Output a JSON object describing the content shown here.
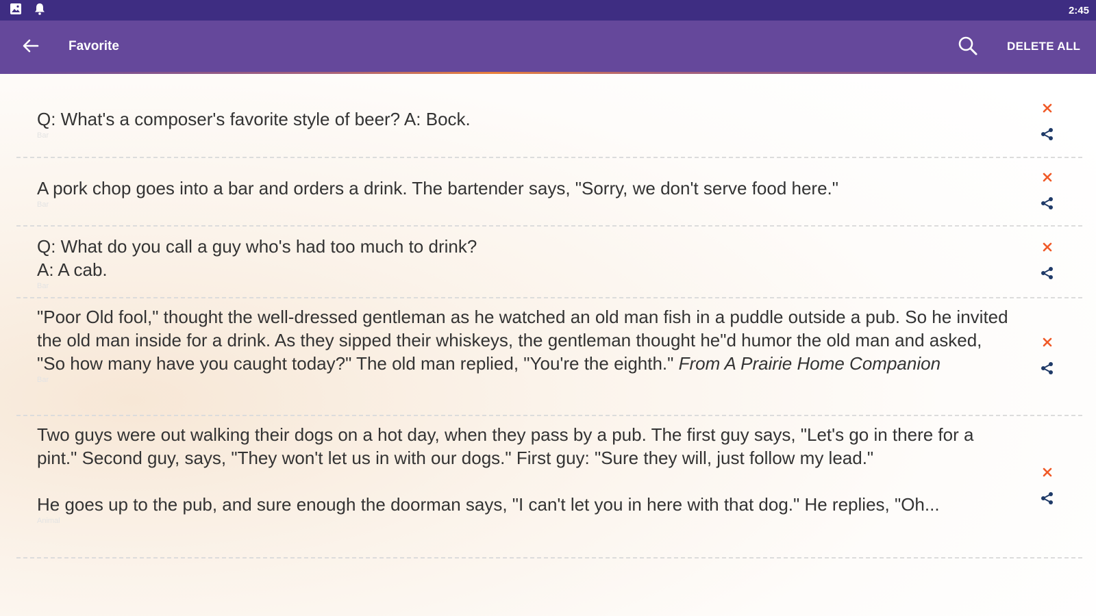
{
  "status_bar": {
    "time": "2:45",
    "icons": [
      "image-icon",
      "notification-bell-icon"
    ]
  },
  "app_bar": {
    "title": "Favorite",
    "back_icon": "arrow-back-icon",
    "search_icon": "search-icon",
    "delete_all_label": "DELETE ALL"
  },
  "colors": {
    "status_bar": "#3e2d82",
    "app_bar": "#65489b",
    "accent": "#f05a28",
    "share_icon": "#1f3a68",
    "text": "#333333"
  },
  "jokes": [
    {
      "text": "Q: What's a composer's favorite style of beer? A: Bock.",
      "category": "Bar"
    },
    {
      "text": "A pork chop goes into a bar and orders a drink. The bartender says, \"Sorry, we don't serve food here.\"",
      "category": "Bar"
    },
    {
      "text": "Q: What do you call a guy who's had too much to drink?\nA: A cab.",
      "category": "Bar"
    },
    {
      "text": "\"Poor Old fool,\" thought the well-dressed gentleman as he watched an old man fish in a puddle outside a pub. So he invited the old man inside for a drink. As they sipped their whiskeys, the gentleman thought he\"d humor the old man and asked, \"So how many have you caught today?\" The old man replied, \"You're the eighth.\"",
      "source": "From A Prairie Home Companion",
      "category": "Bar"
    },
    {
      "text": "Two guys were out walking their dogs on a hot day, when they pass by a pub. The first guy says, \"Let's go in there for a pint.\" Second guy, says, \"They won't let us in with our dogs.\" First guy: \"Sure they will, just follow my lead.\"",
      "text_more": "He goes up to the pub, and sure enough the doorman says, \"I can't let you in here with that dog.\" He replies, \"Oh...",
      "category": "Animal"
    }
  ],
  "item_actions": {
    "delete_icon": "close-icon",
    "share_icon": "share-icon"
  }
}
